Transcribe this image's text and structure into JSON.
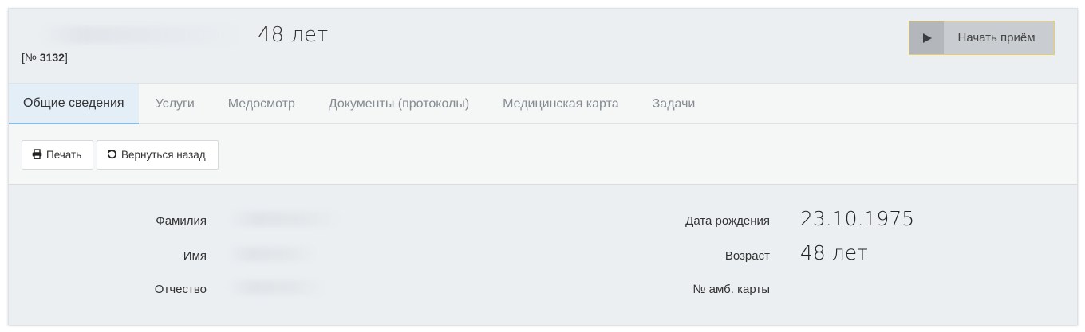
{
  "header": {
    "age": "48 лет",
    "record_prefix": "[№ ",
    "record_number": "3132",
    "record_suffix": "]",
    "start_button_label": "Начать приём",
    "start_button_icon": "play-icon"
  },
  "tabs": [
    {
      "label": "Общие сведения",
      "active": true
    },
    {
      "label": "Услуги"
    },
    {
      "label": "Медосмотр"
    },
    {
      "label": "Документы (протоколы)"
    },
    {
      "label": "Медицинская карта"
    },
    {
      "label": "Задачи"
    }
  ],
  "toolbar": {
    "print_label": "Печать",
    "print_icon": "printer-icon",
    "back_label": "Вернуться назад",
    "back_icon": "undo-icon"
  },
  "info": {
    "surname_label": "Фамилия",
    "name_label": "Имя",
    "patronymic_label": "Отчество",
    "birthdate_label": "Дата рождения",
    "birthdate_value": "23.10.1975",
    "age_label": "Возраст",
    "age_value": "48 лет",
    "card_label": "№ амб. карты"
  },
  "colors": {
    "panel_bg": "#ebeff2",
    "tabs_bg": "#f5f7f7",
    "active_tab_bg": "#e4eef7",
    "active_tab_border": "#86bbe3",
    "start_button_border": "#e6cf6b"
  }
}
